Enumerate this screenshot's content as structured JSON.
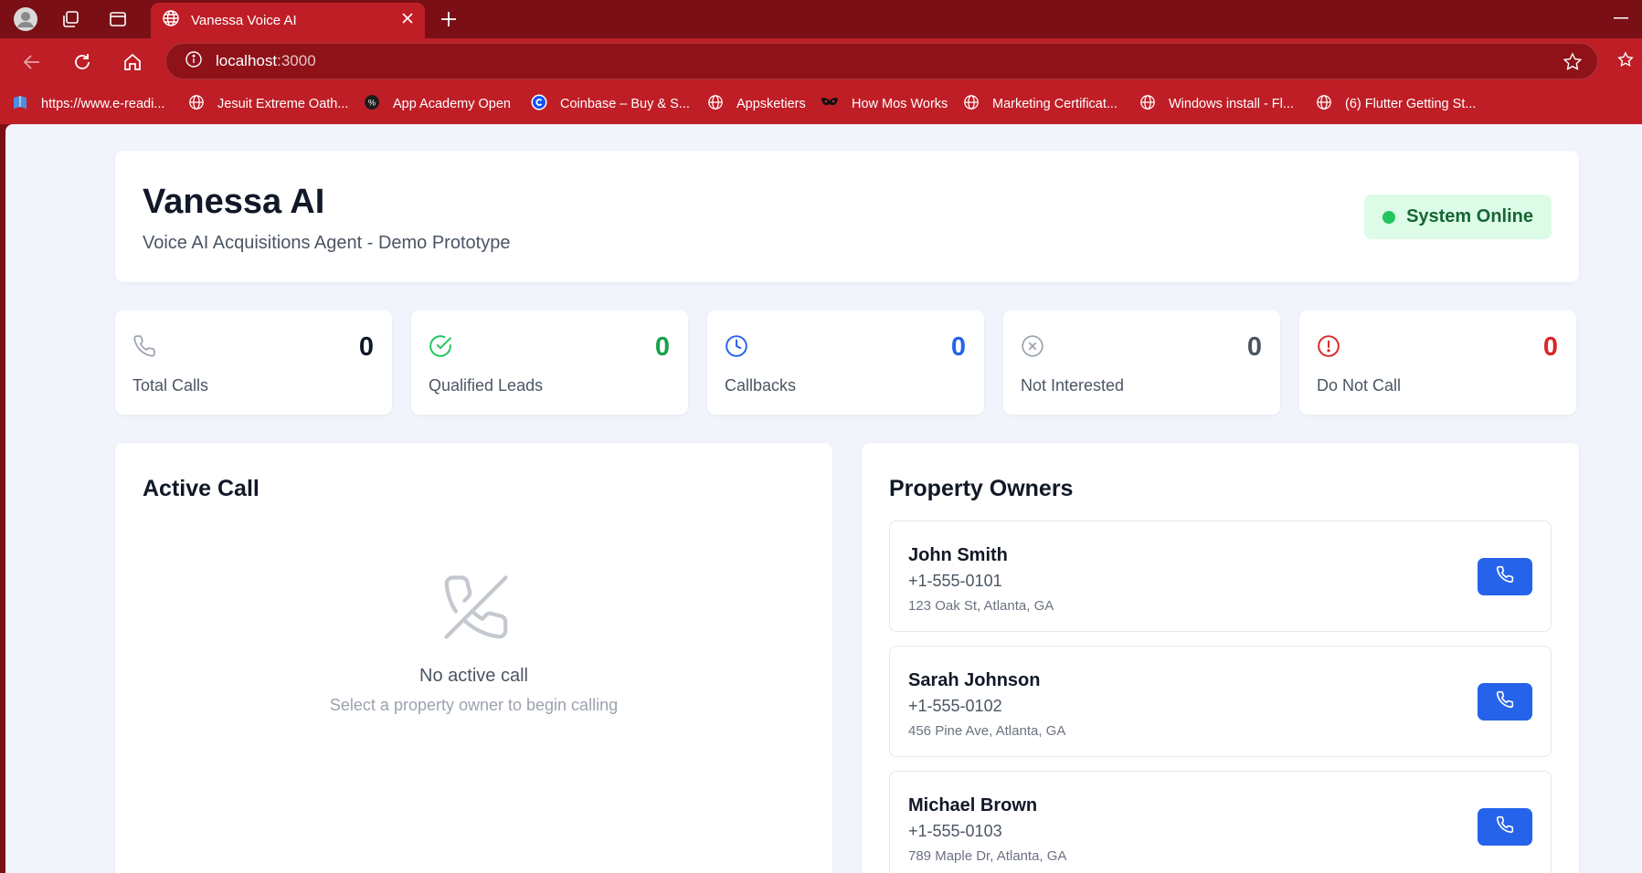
{
  "browser": {
    "tab_title": "Vanessa Voice AI",
    "url_host": "localhost",
    "url_port": ":3000",
    "bookmarks": [
      {
        "label": "https://www.e-readi...",
        "icon": "book-icon"
      },
      {
        "label": "Jesuit Extreme Oath...",
        "icon": "globe-icon"
      },
      {
        "label": "App Academy Open",
        "icon": "app-academy-icon"
      },
      {
        "label": "Coinbase – Buy & S...",
        "icon": "coinbase-icon"
      },
      {
        "label": "Appsketiers",
        "icon": "globe-icon"
      },
      {
        "label": "How Mos Works",
        "icon": "mask-icon"
      },
      {
        "label": "Marketing Certificat...",
        "icon": "globe-icon"
      },
      {
        "label": "Windows install - Fl...",
        "icon": "globe-icon"
      },
      {
        "label": "(6) Flutter Getting St...",
        "icon": "globe-icon"
      }
    ]
  },
  "header": {
    "title": "Vanessa AI",
    "subtitle": "Voice AI Acquisitions Agent - Demo Prototype",
    "status": "System Online",
    "status_color": "#22c55e"
  },
  "stats": [
    {
      "label": "Total Calls",
      "value": "0",
      "icon": "phone-icon",
      "color": "#111827"
    },
    {
      "label": "Qualified Leads",
      "value": "0",
      "icon": "check-circle-icon",
      "color": "#16a34a"
    },
    {
      "label": "Callbacks",
      "value": "0",
      "icon": "clock-icon",
      "color": "#2563eb"
    },
    {
      "label": "Not Interested",
      "value": "0",
      "icon": "x-circle-icon",
      "color": "#4b5563"
    },
    {
      "label": "Do Not Call",
      "value": "0",
      "icon": "alert-circle-icon",
      "color": "#dc2626"
    }
  ],
  "active_call": {
    "title": "Active Call",
    "empty_title": "No active call",
    "empty_subtitle": "Select a property owner to begin calling"
  },
  "owners": {
    "title": "Property Owners",
    "items": [
      {
        "name": "John Smith",
        "phone": "+1-555-0101",
        "address": "123 Oak St, Atlanta, GA"
      },
      {
        "name": "Sarah Johnson",
        "phone": "+1-555-0102",
        "address": "456 Pine Ave, Atlanta, GA"
      },
      {
        "name": "Michael Brown",
        "phone": "+1-555-0103",
        "address": "789 Maple Dr, Atlanta, GA"
      }
    ]
  },
  "colors": {
    "accent": "#2563eb",
    "chrome": "#bf1e27"
  }
}
